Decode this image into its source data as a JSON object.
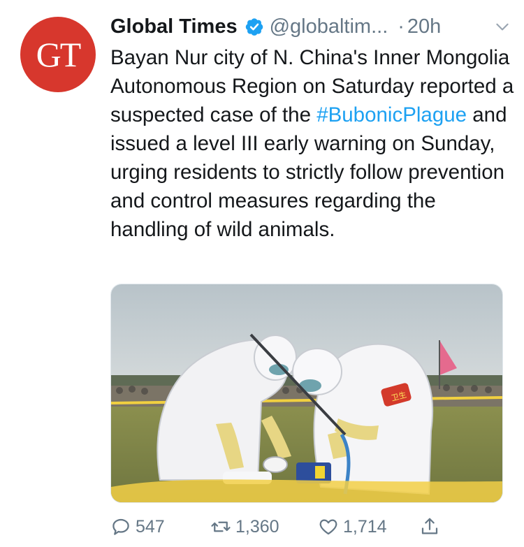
{
  "tweet": {
    "author": {
      "name": "Global Times",
      "handle": "@globaltim...",
      "avatar_text": "GT",
      "verified": true
    },
    "timestamp_sep": "·",
    "timestamp": "20h",
    "text_parts": {
      "before": "Bayan Nur city of N. China's Inner Mongolia Autonomous Region on Saturday reported a suspected case of the ",
      "hashtag": "#BubonicPlague",
      "after": " and issued a level III early warning on Sunday, urging residents to strictly follow prevention and control measures regarding the handling of wild animals."
    },
    "media": {
      "armband_text": "卫生"
    },
    "actions": {
      "reply_count": "547",
      "retweet_count": "1,360",
      "like_count": "1,714"
    }
  },
  "colors": {
    "avatar_bg": "#d7372d",
    "link": "#1da1f2",
    "secondary_text": "#657786",
    "verified": "#1da1f2"
  },
  "icons": [
    "verified-badge-icon",
    "chevron-down-icon",
    "reply-icon",
    "retweet-icon",
    "like-icon",
    "share-icon"
  ]
}
